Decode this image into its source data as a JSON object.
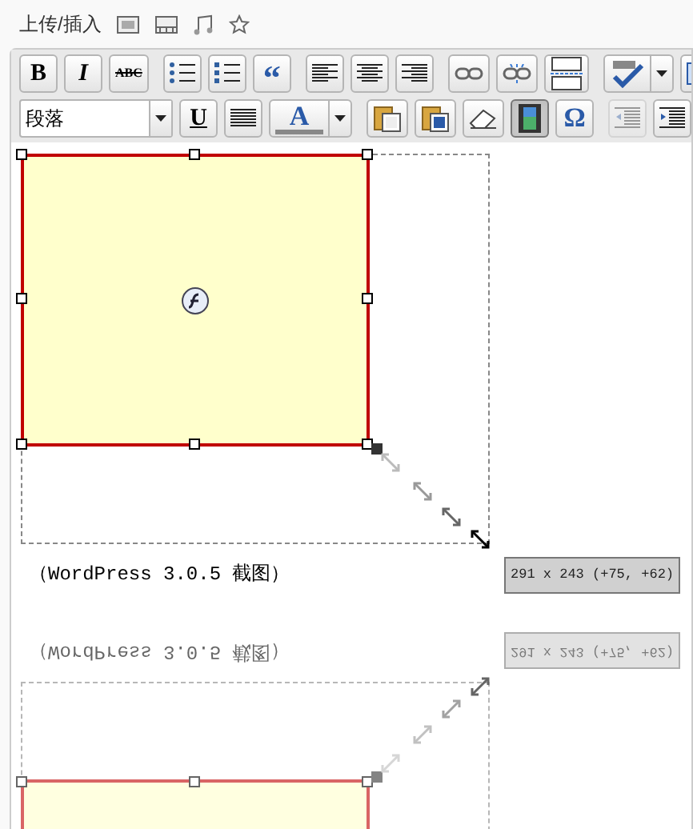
{
  "header": {
    "label": "上传/插入"
  },
  "toolbar": {
    "rows": [
      [
        {
          "kind": "bold",
          "label": "B",
          "pressed": false,
          "disabled": false
        },
        {
          "kind": "italic",
          "label": "I",
          "pressed": false,
          "disabled": false
        },
        {
          "kind": "strike",
          "label": "ABC",
          "pressed": false,
          "disabled": false
        },
        {
          "kind": "icon",
          "pressed": false,
          "disabled": false
        },
        {
          "kind": "icon",
          "pressed": false,
          "disabled": false
        },
        {
          "kind": "quote",
          "label": "“",
          "pressed": false,
          "disabled": false
        },
        {
          "kind": "icon",
          "pressed": false,
          "disabled": false
        },
        {
          "kind": "icon",
          "pressed": false,
          "disabled": false
        },
        {
          "kind": "icon",
          "pressed": false,
          "disabled": false
        },
        {
          "kind": "icon",
          "pressed": false,
          "disabled": false
        },
        {
          "kind": "icon",
          "pressed": false,
          "disabled": false
        },
        {
          "kind": "icon",
          "pressed": false,
          "disabled": false
        },
        {
          "kind": "split",
          "pressed": false,
          "disabled": false
        },
        {
          "kind": "icon",
          "pressed": false,
          "disabled": false
        }
      ],
      [
        {
          "kind": "select",
          "value": "段落"
        },
        {
          "kind": "underline",
          "label": "U",
          "pressed": false,
          "disabled": false
        },
        {
          "kind": "icon",
          "pressed": false,
          "disabled": false
        },
        {
          "kind": "color",
          "label": "A",
          "pressed": false,
          "disabled": false
        },
        {
          "kind": "icon",
          "pressed": false,
          "disabled": false
        },
        {
          "kind": "icon",
          "pressed": false,
          "disabled": false
        },
        {
          "kind": "icon",
          "pressed": false,
          "disabled": false
        },
        {
          "kind": "icon",
          "pressed": true,
          "disabled": false
        },
        {
          "kind": "symbol",
          "label": "Ω",
          "pressed": false,
          "disabled": false
        },
        {
          "kind": "icon",
          "pressed": false,
          "disabled": true
        },
        {
          "kind": "icon",
          "pressed": false,
          "disabled": false
        }
      ]
    ]
  },
  "editor": {
    "object": {
      "selected": true
    },
    "caption": "（WordPress 3.0.5 截图）",
    "tooltip": "291 x 243 (+75, +62)"
  },
  "reflection": {
    "caption": "（WordPress 3.0.5 截图）",
    "tooltip": "291 x 243 (+75, +62)"
  }
}
